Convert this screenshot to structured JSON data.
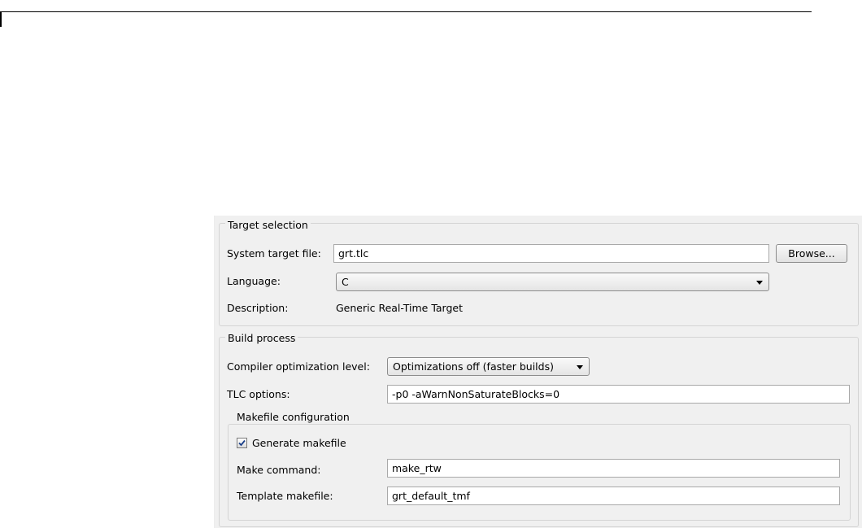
{
  "target_selection": {
    "legend": "Target selection",
    "system_target_file_label": "System target file:",
    "system_target_file_value": "grt.tlc",
    "browse_label": "Browse...",
    "language_label": "Language:",
    "language_value": "C",
    "description_label": "Description:",
    "description_value": "Generic Real-Time Target"
  },
  "build_process": {
    "legend": "Build process",
    "compiler_opt_label": "Compiler optimization level:",
    "compiler_opt_value": "Optimizations off (faster builds)",
    "tlc_options_label": "TLC options:",
    "tlc_options_value": "-p0 -aWarnNonSaturateBlocks=0",
    "makefile_config": {
      "legend": "Makefile configuration",
      "generate_makefile_label": "Generate makefile",
      "generate_makefile_checked": true,
      "make_command_label": "Make command:",
      "make_command_value": "make_rtw",
      "template_makefile_label": "Template makefile:",
      "template_makefile_value": "grt_default_tmf"
    }
  },
  "icons": {
    "dropdown": "chevron-down-icon",
    "check": "check-icon"
  }
}
